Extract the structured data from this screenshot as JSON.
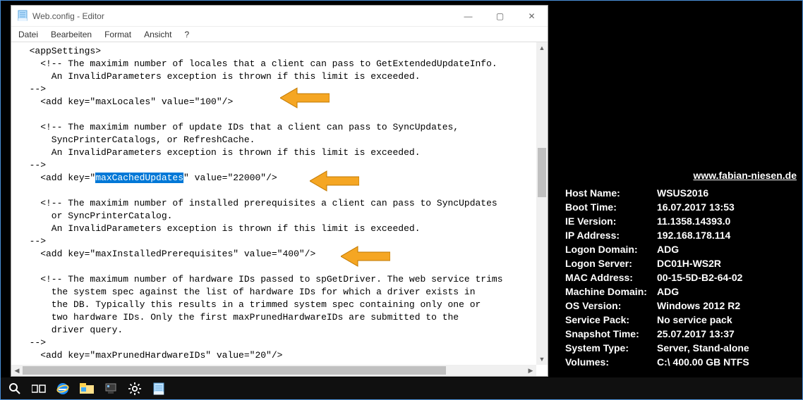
{
  "window": {
    "title": "Web.config - Editor",
    "minimize_glyph": "—",
    "maximize_glyph": "▢",
    "close_glyph": "✕"
  },
  "menu": {
    "datei": "Datei",
    "bearbeiten": "Bearbeiten",
    "format": "Format",
    "ansicht": "Ansicht",
    "help": "?"
  },
  "code": {
    "l1": "  <appSettings>",
    "l2": "    <!-- The maximim number of locales that a client can pass to GetExtendedUpdateInfo.",
    "l3": "      An InvalidParameters exception is thrown if this limit is exceeded.",
    "l4": "  -->",
    "l5": "    <add key=\"maxLocales\" value=\"100\"/>",
    "l6": "",
    "l7": "    <!-- The maximim number of update IDs that a client can pass to SyncUpdates,",
    "l8": "      SyncPrinterCatalogs, or RefreshCache.",
    "l9": "      An InvalidParameters exception is thrown if this limit is exceeded.",
    "l10": "  -->",
    "l11a": "    <add key=\"",
    "l11b": "maxCachedUpdates",
    "l11c": "\" value=\"22000\"/>",
    "l12": "",
    "l13": "    <!-- The maximim number of installed prerequisites a client can pass to SyncUpdates",
    "l14": "      or SyncPrinterCatalog.",
    "l15": "      An InvalidParameters exception is thrown if this limit is exceeded.",
    "l16": "  -->",
    "l17": "    <add key=\"maxInstalledPrerequisites\" value=\"400\"/>",
    "l18": "",
    "l19": "    <!-- The maximum number of hardware IDs passed to spGetDriver. The web service trims",
    "l20": "      the system spec against the list of hardware IDs for which a driver exists in",
    "l21": "      the DB. Typically this results in a trimmed system spec containing only one or",
    "l22": "      two hardware IDs. Only the first maxPrunedHardwareIDs are submitted to the",
    "l23": "      driver query.",
    "l24": "  -->",
    "l25": "    <add key=\"maxPrunedHardwareIDs\" value=\"20\"/>"
  },
  "bginfo": {
    "link": "www.fabian-niesen.de",
    "rows": [
      {
        "k": "Host Name:",
        "v": "WSUS2016"
      },
      {
        "k": "Boot Time:",
        "v": "16.07.2017 13:53"
      },
      {
        "k": "IE Version:",
        "v": "11.1358.14393.0"
      },
      {
        "k": "IP Address:",
        "v": "192.168.178.114"
      },
      {
        "k": "Logon Domain:",
        "v": "ADG"
      },
      {
        "k": "Logon Server:",
        "v": "DC01H-WS2R"
      },
      {
        "k": "MAC Address:",
        "v": "00-15-5D-B2-64-02"
      },
      {
        "k": "Machine Domain:",
        "v": "ADG"
      },
      {
        "k": "OS Version:",
        "v": "Windows 2012 R2"
      },
      {
        "k": "Service Pack:",
        "v": "No service pack"
      },
      {
        "k": "Snapshot Time:",
        "v": "25.07.2017 13:37"
      },
      {
        "k": "System Type:",
        "v": "Server, Stand-alone"
      },
      {
        "k": "Volumes:",
        "v": "C:\\ 400.00 GB NTFS"
      }
    ]
  },
  "scroll": {
    "left": "◀",
    "right": "▶",
    "up": "▲",
    "down": "▼"
  }
}
